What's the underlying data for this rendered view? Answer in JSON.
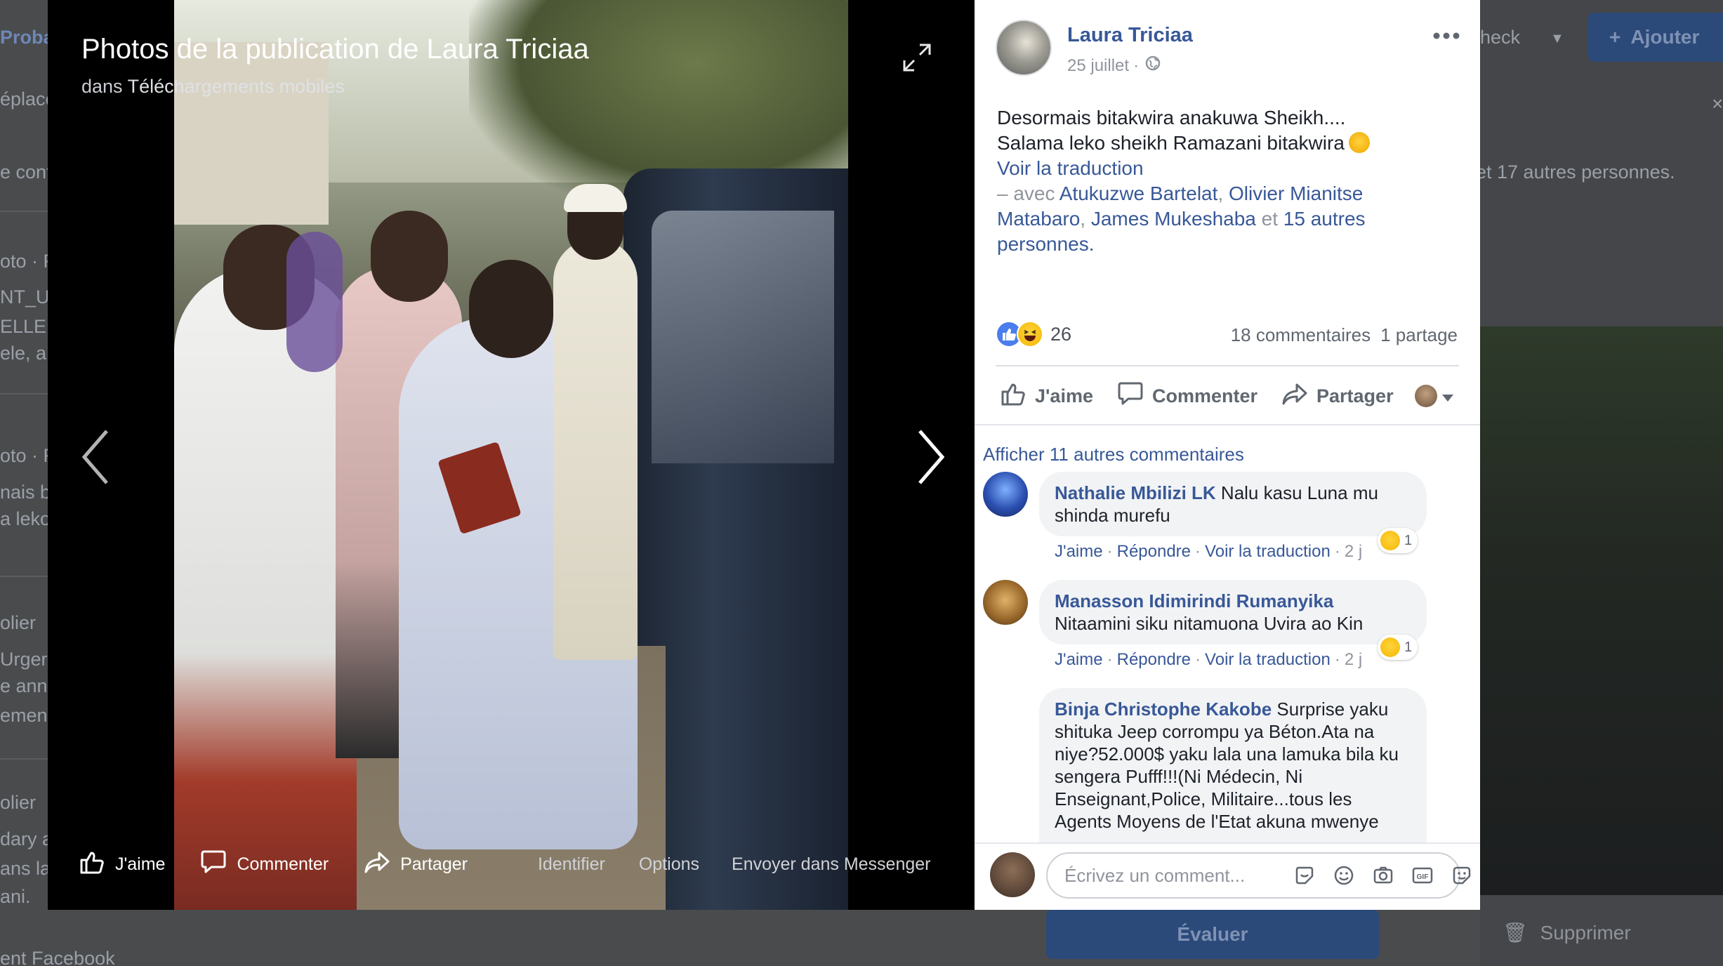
{
  "background_page": {
    "left_fragments": [
      "Proba",
      "éplace",
      "e cont",
      "oto · F",
      "NT_U",
      "ELLE",
      "ele, a",
      "oto · F",
      "nais b",
      "a leko",
      "olier",
      "Urger",
      "e ann",
      "emen",
      "olier",
      "dary a",
      "ans la",
      "ani.",
      "ent Facebook"
    ],
    "right_check": "heck",
    "add_button": "Ajouter",
    "others_text": "et 17 autres personnes.",
    "evaluate_button": "Évaluer",
    "delete_button": "Supprimer"
  },
  "viewer": {
    "title": "Photos de la publication de Laura Triciaa",
    "subtitle_prefix": "dans",
    "subtitle_album": "Téléchargements mobiles",
    "actions": {
      "like": "J'aime",
      "comment": "Commenter",
      "share": "Partager",
      "tag": "Identifier",
      "options": "Options",
      "messenger": "Envoyer dans Messenger"
    }
  },
  "post": {
    "author": "Laura Triciaa",
    "date": "25 juillet",
    "separator": "·",
    "text_line1": "Desormais bitakwira anakuwa Sheikh....",
    "text_line2": "Salama leko sheikh Ramazani bitakwira",
    "see_translation": "Voir la traduction",
    "with_prefix": "– avec",
    "tag1": "Atukuzwe Bartelat",
    "tag2": "Olivier Mianitse",
    "tag3": "Matabaro",
    "tag4": "James Mukeshaba",
    "and_word": "et",
    "others_link1": "15 autres",
    "others_link2": "personnes",
    "period": ".",
    "comma": ",",
    "reaction_count": "26",
    "comments_count": "18 commentaires",
    "shares_count": "1 partage",
    "actions": {
      "like": "J'aime",
      "comment": "Commenter",
      "share": "Partager"
    }
  },
  "comments": {
    "show_more": "Afficher 11 autres commentaires",
    "items": [
      {
        "name": "Nathalie Mbilizi LK",
        "text_a": "Nalu kasu Luna mu",
        "text_b": "shinda murefu",
        "like": "J'aime",
        "reply": "Répondre",
        "translate": "Voir la traduction",
        "time": "2 j",
        "reaction_count": "1"
      },
      {
        "name": "Manasson Idimirindi Rumanyika",
        "text_a": "Nitaamini siku nitamuona Uvira ao Kin",
        "like": "J'aime",
        "reply": "Répondre",
        "translate": "Voir la traduction",
        "time": "2 j",
        "reaction_count": "1"
      },
      {
        "name": "Binja Christophe Kakobe",
        "text_a": "Surprise yaku",
        "lines": [
          "shituka Jeep corrompu ya Béton.Ata na",
          "niye?52.000$ yaku lala una lamuka bila ku",
          "sengera Pufff!!!(Ni Médecin, Ni",
          "Enseignant,Police, Militaire...tous les",
          "Agents Moyens de l'Etat akuna mwenye"
        ]
      }
    ],
    "composer_placeholder": "Écrivez un comment..."
  },
  "colors": {
    "link": "#385898",
    "like_blue": "#4a7ded",
    "panel_bg": "#ffffff",
    "viewer_bg": "#000000"
  },
  "icons": [
    "expand-icon",
    "chevron-left-icon",
    "chevron-right-icon",
    "thumbs-up-icon",
    "comment-icon",
    "share-icon",
    "globe-icon",
    "more-icon",
    "sticker-icon",
    "emoji-icon",
    "camera-icon",
    "gif-icon",
    "sticker-pack-icon"
  ]
}
